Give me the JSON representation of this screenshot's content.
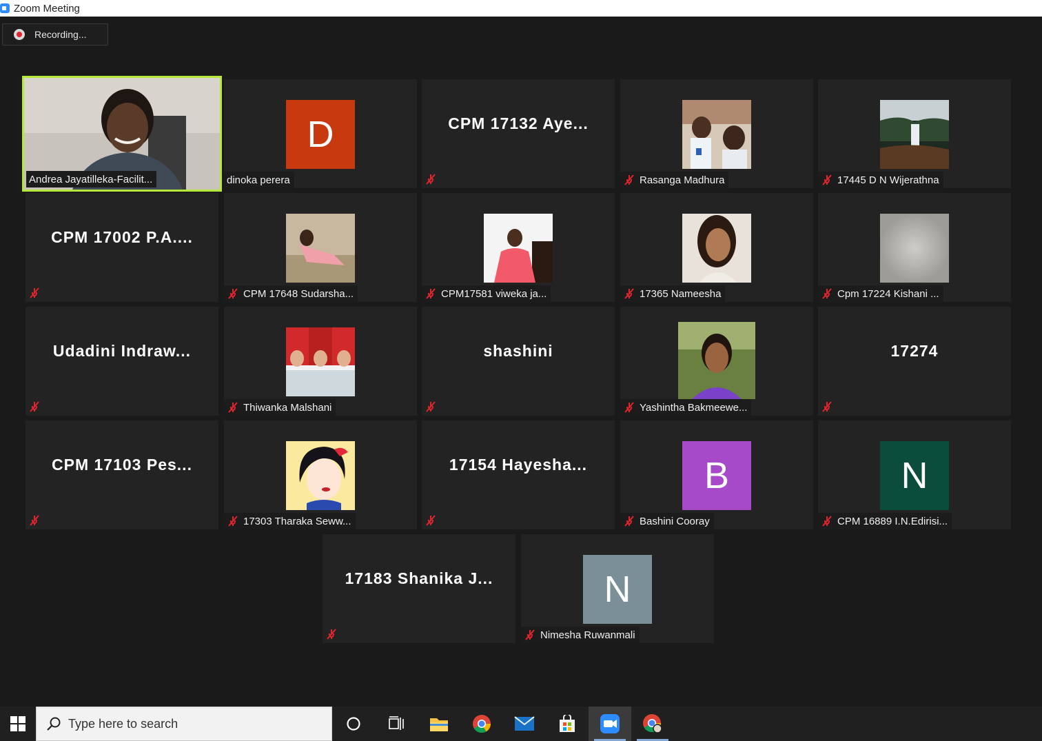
{
  "window": {
    "title": "Zoom Meeting"
  },
  "recording": {
    "label": "Recording..."
  },
  "participants": [
    {
      "name": "Andrea Jayatilleka-Facilit...",
      "type": "video",
      "active": true
    },
    {
      "name": "dinoka perera",
      "type": "avatar",
      "initial": "D",
      "color": "#c8390f",
      "muted": false
    },
    {
      "name": "CPM 17132 Aye...",
      "type": "text",
      "muted": true
    },
    {
      "name": "Rasanga Madhura",
      "type": "photo",
      "muted": true
    },
    {
      "name": "17445 D N Wijerathna",
      "type": "photo",
      "muted": true
    },
    {
      "name": "CPM 17002 P.A....",
      "type": "text",
      "muted": true
    },
    {
      "name": "CPM 17648 Sudarsha...",
      "type": "photo",
      "muted": true
    },
    {
      "name": "CPM17581 viweka ja...",
      "type": "photo",
      "muted": true
    },
    {
      "name": "17365 Nameesha",
      "type": "photo",
      "muted": true
    },
    {
      "name": "Cpm 17224 Kishani ...",
      "type": "photo",
      "muted": true
    },
    {
      "name": "Udadini Indraw...",
      "type": "text",
      "muted": true
    },
    {
      "name": "Thiwanka Malshani",
      "type": "photo",
      "muted": true
    },
    {
      "name": "shashini",
      "type": "text",
      "muted": true
    },
    {
      "name": "Yashintha Bakmeewe...",
      "type": "photo",
      "muted": true
    },
    {
      "name": "17274",
      "type": "text",
      "muted": true
    },
    {
      "name": "CPM 17103 Pes...",
      "type": "text",
      "muted": true
    },
    {
      "name": "17303 Tharaka Seww...",
      "type": "photo",
      "muted": true
    },
    {
      "name": "17154 Hayesha...",
      "type": "text",
      "muted": true
    },
    {
      "name": "Bashini Cooray",
      "type": "avatar",
      "initial": "B",
      "color": "#a64ac9",
      "muted": true
    },
    {
      "name": "CPM 16889 I.N.Edirisi...",
      "type": "avatar",
      "initial": "N",
      "color": "#0a4d3c",
      "muted": true
    },
    {
      "name": "17183 Shanika J...",
      "type": "text",
      "muted": true
    },
    {
      "name": "Nimesha Ruwanmali",
      "type": "avatar",
      "initial": "N",
      "color": "#7b8f99",
      "muted": true
    }
  ],
  "taskbar": {
    "search_placeholder": "Type here to search",
    "icons": [
      "windows-start-icon",
      "cortana-icon",
      "task-view-icon",
      "file-explorer-icon",
      "chrome-icon",
      "mail-icon",
      "store-icon",
      "zoom-icon",
      "chrome-profile-icon"
    ]
  }
}
